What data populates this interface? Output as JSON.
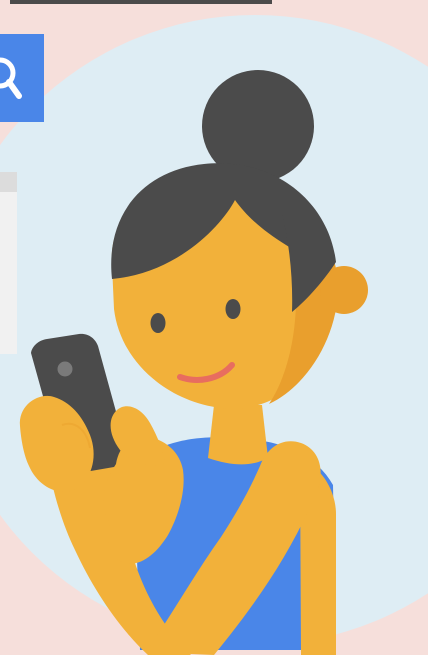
{
  "illustration": {
    "icons": {
      "search_button": "search-icon",
      "person": "woman-with-phone-illustration",
      "phone": "smartphone-icon"
    },
    "colors": {
      "page_background": "#f6dfdb",
      "circle_background": "#deedf4",
      "search_button": "#4a86e8",
      "top_bar": "#4b4b4b",
      "side_panel": "#f1f1f1",
      "hair": "#4b4b4b",
      "skin": "#f2b13a",
      "skin_shadow": "#e99f2d",
      "shirt": "#4a86e8",
      "phone": "#4b4b4b",
      "smile": "#e86d5f"
    }
  }
}
